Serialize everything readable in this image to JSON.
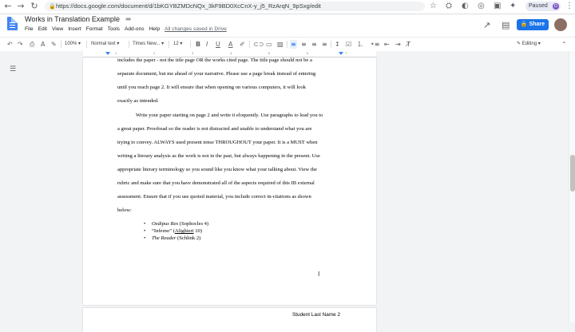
{
  "browser": {
    "url": "https://docs.google.com/document/d/1bKGYBZMDcNQx_3kF9BD0XcCnX-y_j5_RzArqN_9pSxg/edit",
    "profile_status": "Paused",
    "profile_initial": "D"
  },
  "doc": {
    "title": "Works in Translation Example",
    "menu": [
      "File",
      "Edit",
      "View",
      "Insert",
      "Format",
      "Tools",
      "Add-ons",
      "Help"
    ],
    "save_status": "All changes saved in Drive",
    "share_label": "Share"
  },
  "toolbar": {
    "zoom": "100%",
    "style": "Normal text",
    "font": "Times New...",
    "font_size": "12",
    "mode": "Editing"
  },
  "ruler": {
    "numbers": [
      "1",
      "2",
      "3",
      "4",
      "5",
      "6",
      "7"
    ]
  },
  "page": {
    "lines": [
      "includes the paper - not the title page OR the works cited page. The title page should not be a",
      "separate document, but me ahead of your narrative. Please use a page break instead of entering",
      "until you reach page 2. It will ensure that when opening on various computers, it will look",
      "exactly as intended.",
      "Write your paper starting on page 2 and write it eloquently. Use paragraphs to lead you to",
      "a great paper. Proofread so the reader is not distracted and unable to understand what you are",
      "trying to convey. ALWAYS used present tense THROUGHOUT your paper. It is a MUST when",
      "writing a literary analysis as the work is not in the past, but always happening in the present. Use",
      "appropriate literary terminology so you sound like you know what your talking about. View the",
      "rubric and make sure that you have demonstrated all of the aspects required of this IB external",
      "assessment. Ensure that if you use quoted material, you include correct in-citations as shown",
      "below:"
    ],
    "bullets": [
      {
        "title": "Oedipus Rex",
        "rest_pre": "",
        "rest_link": "",
        "rest": " (Sophocles 4)"
      },
      {
        "title": "“Inferno”",
        "rest_pre": " (",
        "rest_link": "Alighieri",
        "rest": " 10)"
      },
      {
        "title": "The Reader",
        "rest_pre": "",
        "rest_link": "",
        "rest": " (Schlink 2)"
      }
    ],
    "next_page_header": "Student Last Name 2"
  }
}
